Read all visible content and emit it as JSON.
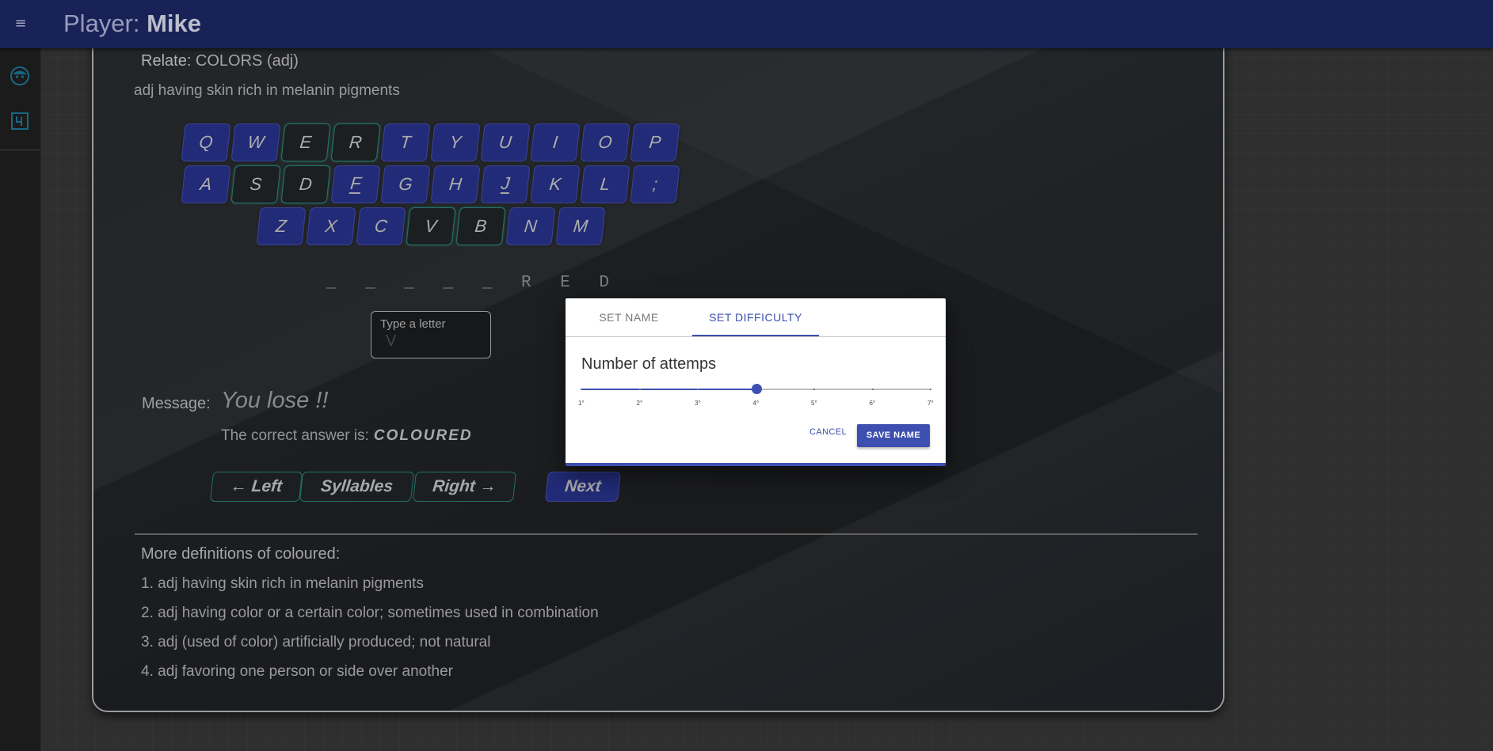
{
  "appbar": {
    "title_prefix": "Player: ",
    "player_name": "Mike",
    "menu_icon": "≡"
  },
  "rail": {
    "icons": [
      "face-icon",
      "level-icon"
    ]
  },
  "game": {
    "relate_label": "Relate:",
    "relate_value": " COLORS (adj)",
    "definition": "adj having skin rich in melanin pigments",
    "keyboard": {
      "row1": [
        "Q",
        "W",
        "E",
        "R",
        "T",
        "Y",
        "U",
        "I",
        "O",
        "P"
      ],
      "row2": [
        "A",
        "S",
        "D",
        "F",
        "G",
        "H",
        "J",
        "K",
        "L",
        ";"
      ],
      "row3": [
        "Z",
        "X",
        "C",
        "V",
        "B",
        "N",
        "M"
      ],
      "used_keys": [
        "E",
        "R",
        "S",
        "D",
        "V",
        "B"
      ],
      "underlined_keys": [
        "F",
        "J"
      ]
    },
    "word_display": "_ _ _ _ _ R E D",
    "letter_input": {
      "label": "Type a letter",
      "value": "V"
    },
    "message_label": "Message:",
    "message_text": "You lose !!",
    "correct_prefix": "The correct answer is:",
    "correct_word": "COLOURED",
    "buttons": {
      "left": "← Left",
      "syllables": "Syllables",
      "right": "Right →",
      "next": "Next"
    }
  },
  "more": {
    "title": "More definitions of coloured:",
    "items": [
      "1. adj having skin rich in melanin pigments",
      "2. adj having color or a certain color; sometimes used in combination",
      "3. adj (used of color) artificially produced; not natural",
      "4. adj favoring one person or side over another"
    ]
  },
  "dialog": {
    "tabs": [
      "SET NAME",
      "SET DIFFICULTY"
    ],
    "active_tab": 1,
    "heading": "Number of attemps",
    "slider": {
      "min": 1,
      "max": 7,
      "value": 4,
      "labels": [
        "1°",
        "2°",
        "3°",
        "4°",
        "5°",
        "6°",
        "7°"
      ]
    },
    "cancel_label": "CANCEL",
    "save_label": "SAVE NAME"
  },
  "colors": {
    "appbar": "#1f2a6b",
    "accent": "#3d4fb0",
    "key_active": "#2a3592",
    "key_used_border": "#2b8a7e"
  }
}
